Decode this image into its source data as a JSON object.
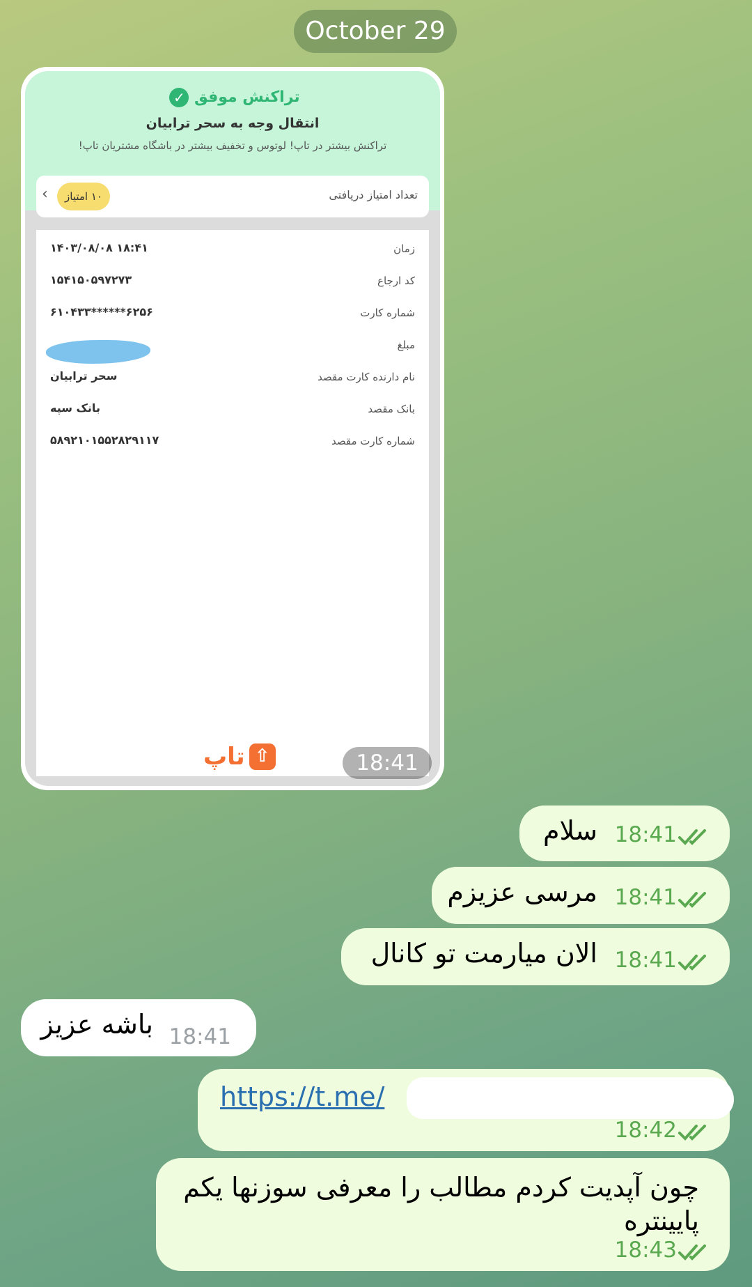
{
  "date_separator": "October 29",
  "receipt": {
    "status": "تراکنش موفق",
    "title": "انتقال وجه به سحر ترابیان",
    "promo": "تراکنش بیشتر در تاپ! لوتوس و تخفیف بیشتر در باشگاه مشتریان تاپ!",
    "points_label": "تعداد امتیاز دریافتی",
    "points_badge": "۱۰ امتیاز",
    "rows": [
      {
        "label": "زمان",
        "value": "۱۴۰۳/۰۸/۰۸ ۱۸:۴۱"
      },
      {
        "label": "کد ارجاع",
        "value": "۱۵۴۱۵۰۵۹۷۲۷۳"
      },
      {
        "label": "شماره کارت",
        "value": "۶۱۰۴۳۳******۶۲۵۶"
      },
      {
        "label": "مبلغ",
        "value": ""
      },
      {
        "label": "نام دارنده کارت مقصد",
        "value": "سحر ترابیان"
      },
      {
        "label": "بانک مقصد",
        "value": "بانک سپه"
      },
      {
        "label": "شماره کارت مقصد",
        "value": "۵۸۹۲۱۰۱۵۵۲۸۲۹۱۱۷"
      }
    ],
    "brand": "تاپ",
    "photo_time": "18:41"
  },
  "messages": [
    {
      "dir": "out",
      "text": "سلام",
      "time": "18:41"
    },
    {
      "dir": "out",
      "text": "مرسی عزیزم",
      "time": "18:41"
    },
    {
      "dir": "out",
      "text": "الان میارمت تو کانال",
      "time": "18:41"
    },
    {
      "dir": "in",
      "text": "باشه عزیز",
      "time": "18:41"
    },
    {
      "dir": "out",
      "link": "https://t.me/",
      "time": "18:42"
    },
    {
      "dir": "out",
      "text": "چون آپدیت کردم مطالب را معرفی سوزنها یکم پایینتره",
      "time": "18:43"
    }
  ],
  "colors": {
    "outgoing": "#effdde",
    "incoming": "#ffffff",
    "accent": "#5aa84f",
    "link": "#2a6fb0"
  }
}
